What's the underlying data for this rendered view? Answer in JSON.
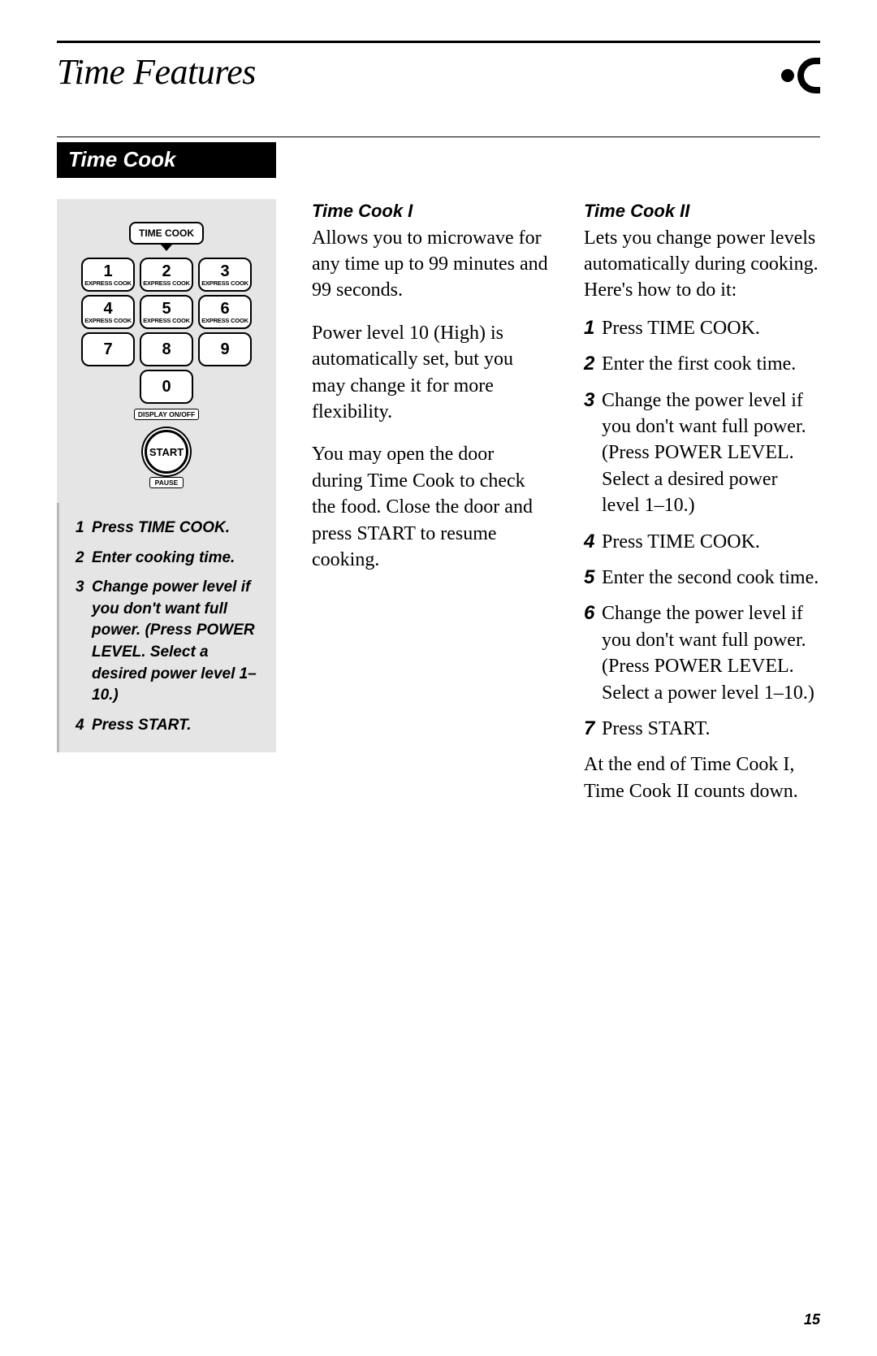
{
  "header": {
    "page_title": "Time Features",
    "section_title": "Time Cook"
  },
  "keypad": {
    "time_cook_label": "TIME COOK",
    "express": "EXPRESS COOK",
    "display_label": "DISPLAY ON/OFF",
    "start_label": "START",
    "pause_label": "PAUSE",
    "keys": [
      "1",
      "2",
      "3",
      "4",
      "5",
      "6",
      "7",
      "8",
      "9",
      "0"
    ]
  },
  "panel_steps": [
    "Press TIME COOK.",
    "Enter cooking time.",
    "Change power level if you don't want full power. (Press POWER LEVEL. Select a desired power level 1–10.)",
    "Press START."
  ],
  "mid": {
    "heading": "Time Cook I",
    "p1": "Allows you to microwave for any time up to 99 minutes and 99 seconds.",
    "p2": "Power level 10 (High) is automatically set, but you may change it for more flexibility.",
    "p3": "You may open the door during Time Cook to check the food. Close the door and press START to resume cooking."
  },
  "right": {
    "heading": "Time Cook II",
    "intro": "Lets you change power levels automatically during cooking. Here's how to do it:",
    "steps": [
      "Press TIME COOK.",
      "Enter the first cook time.",
      "Change the power level if you don't want full power. (Press POWER LEVEL. Select a desired power level 1–10.)",
      "Press TIME COOK.",
      "Enter the second cook time.",
      "Change the power level if you don't want full power. (Press POWER LEVEL. Select a power level 1–10.)",
      "Press START."
    ],
    "closing": "At the end of Time Cook I, Time Cook II counts down."
  },
  "page_number": "15"
}
